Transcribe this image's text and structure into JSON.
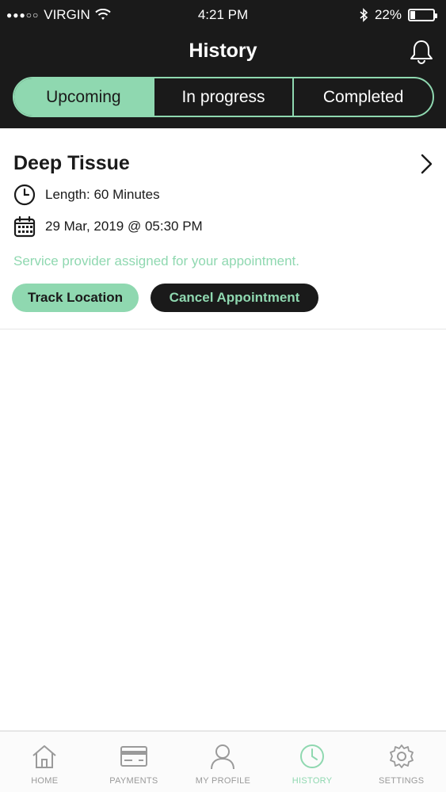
{
  "status_bar": {
    "carrier": "VIRGIN",
    "signal_dots": "●●●○○",
    "time": "4:21 PM",
    "battery_percent": "22%",
    "battery_level": 0.22
  },
  "header": {
    "title": "History"
  },
  "tabs": [
    {
      "label": "Upcoming",
      "active": true
    },
    {
      "label": "In progress",
      "active": false
    },
    {
      "label": "Completed",
      "active": false
    }
  ],
  "appointment": {
    "service": "Deep Tissue",
    "length": "Length: 60 Minutes",
    "datetime": "29 Mar, 2019 @ 05:30 PM",
    "status_message": "Service provider assigned for your appointment.",
    "track_label": "Track Location",
    "cancel_label": "Cancel Appointment"
  },
  "bottom_nav": [
    {
      "label": "HOME",
      "icon": "home-icon"
    },
    {
      "label": "PAYMENTS",
      "icon": "payments-icon"
    },
    {
      "label": "MY PROFILE",
      "icon": "profile-icon"
    },
    {
      "label": "HISTORY",
      "icon": "history-icon",
      "active": true
    },
    {
      "label": "SETTINGS",
      "icon": "settings-icon"
    }
  ],
  "colors": {
    "accent": "#8fd8b0",
    "dark": "#1a1a1a",
    "inactive": "#9a9a9a"
  }
}
